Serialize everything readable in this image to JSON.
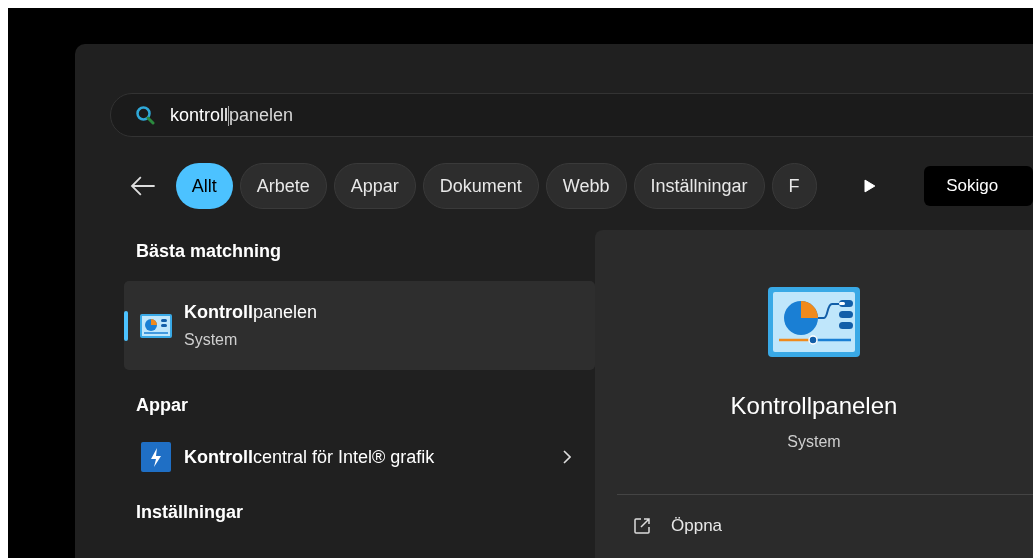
{
  "search": {
    "typed": "kontroll",
    "suggestion": "panelen"
  },
  "filters": [
    {
      "label": "Allt",
      "selected": true
    },
    {
      "label": "Arbete",
      "selected": false
    },
    {
      "label": "Appar",
      "selected": false
    },
    {
      "label": "Dokument",
      "selected": false
    },
    {
      "label": "Webb",
      "selected": false
    },
    {
      "label": "Inställningar",
      "selected": false
    },
    {
      "label": "F",
      "selected": false
    }
  ],
  "account_button": "Sokigo",
  "sections": [
    {
      "heading": "Bästa matchning",
      "items": [
        {
          "kind": "best",
          "title": "**Kontroll**panelen",
          "subtitle": "System",
          "selected": true
        }
      ]
    },
    {
      "heading": "Appar",
      "items": [
        {
          "kind": "app",
          "title": "**Kontroll**central för Intel® grafik",
          "selected": false
        }
      ]
    },
    {
      "heading": "Inställningar"
    }
  ],
  "detail": {
    "title": "Kontrollpanelen",
    "subtitle": "System",
    "actions": [
      "Öppna"
    ]
  }
}
